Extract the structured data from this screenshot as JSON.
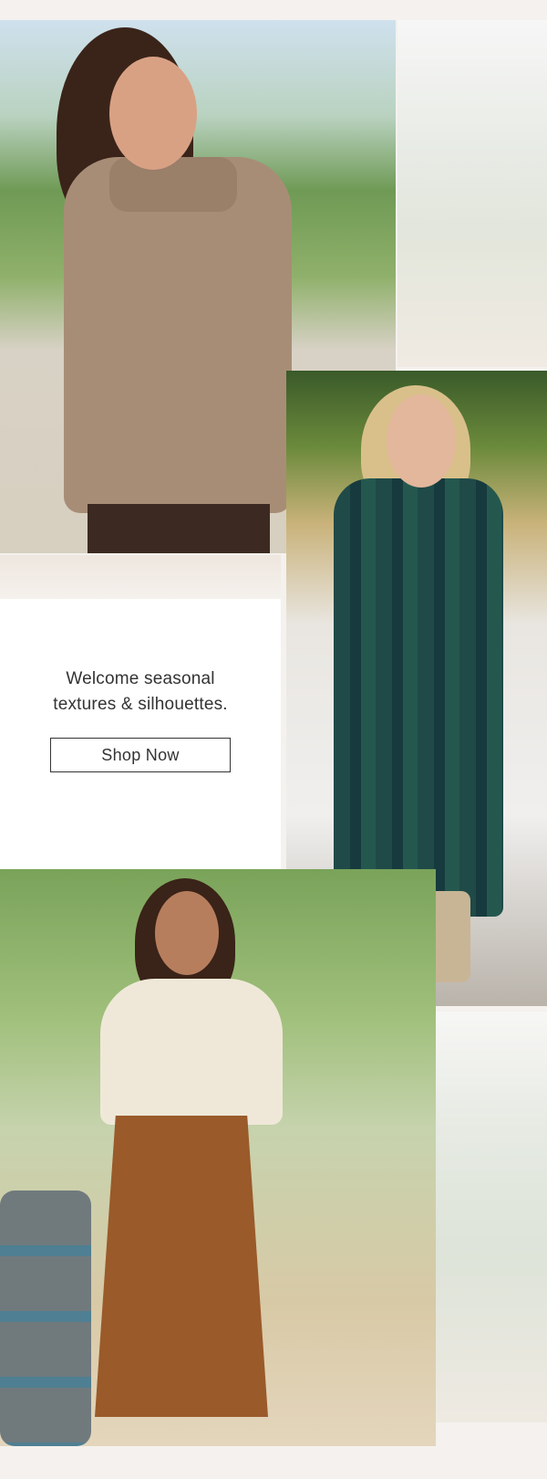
{
  "card": {
    "tagline": "Welcome seasonal\ntextures & silhouettes.",
    "cta_label": "Shop Now"
  },
  "colors": {
    "page_background": "#f4f1ee",
    "card_background": "#ffffff",
    "text": "#333333",
    "button_border": "#333333"
  },
  "photos": [
    {
      "name": "photo-knit-sweater",
      "subject": "woman-in-taupe-half-zip-knit-sweater"
    },
    {
      "name": "photo-plaid-shirt-dress",
      "subject": "woman-in-green-plaid-shirt-dress-by-vintage-car"
    },
    {
      "name": "photo-suede-ruffle-skirt",
      "subject": "woman-in-ivory-sweater-and-brown-ruffle-skirt-in-vineyard"
    }
  ]
}
